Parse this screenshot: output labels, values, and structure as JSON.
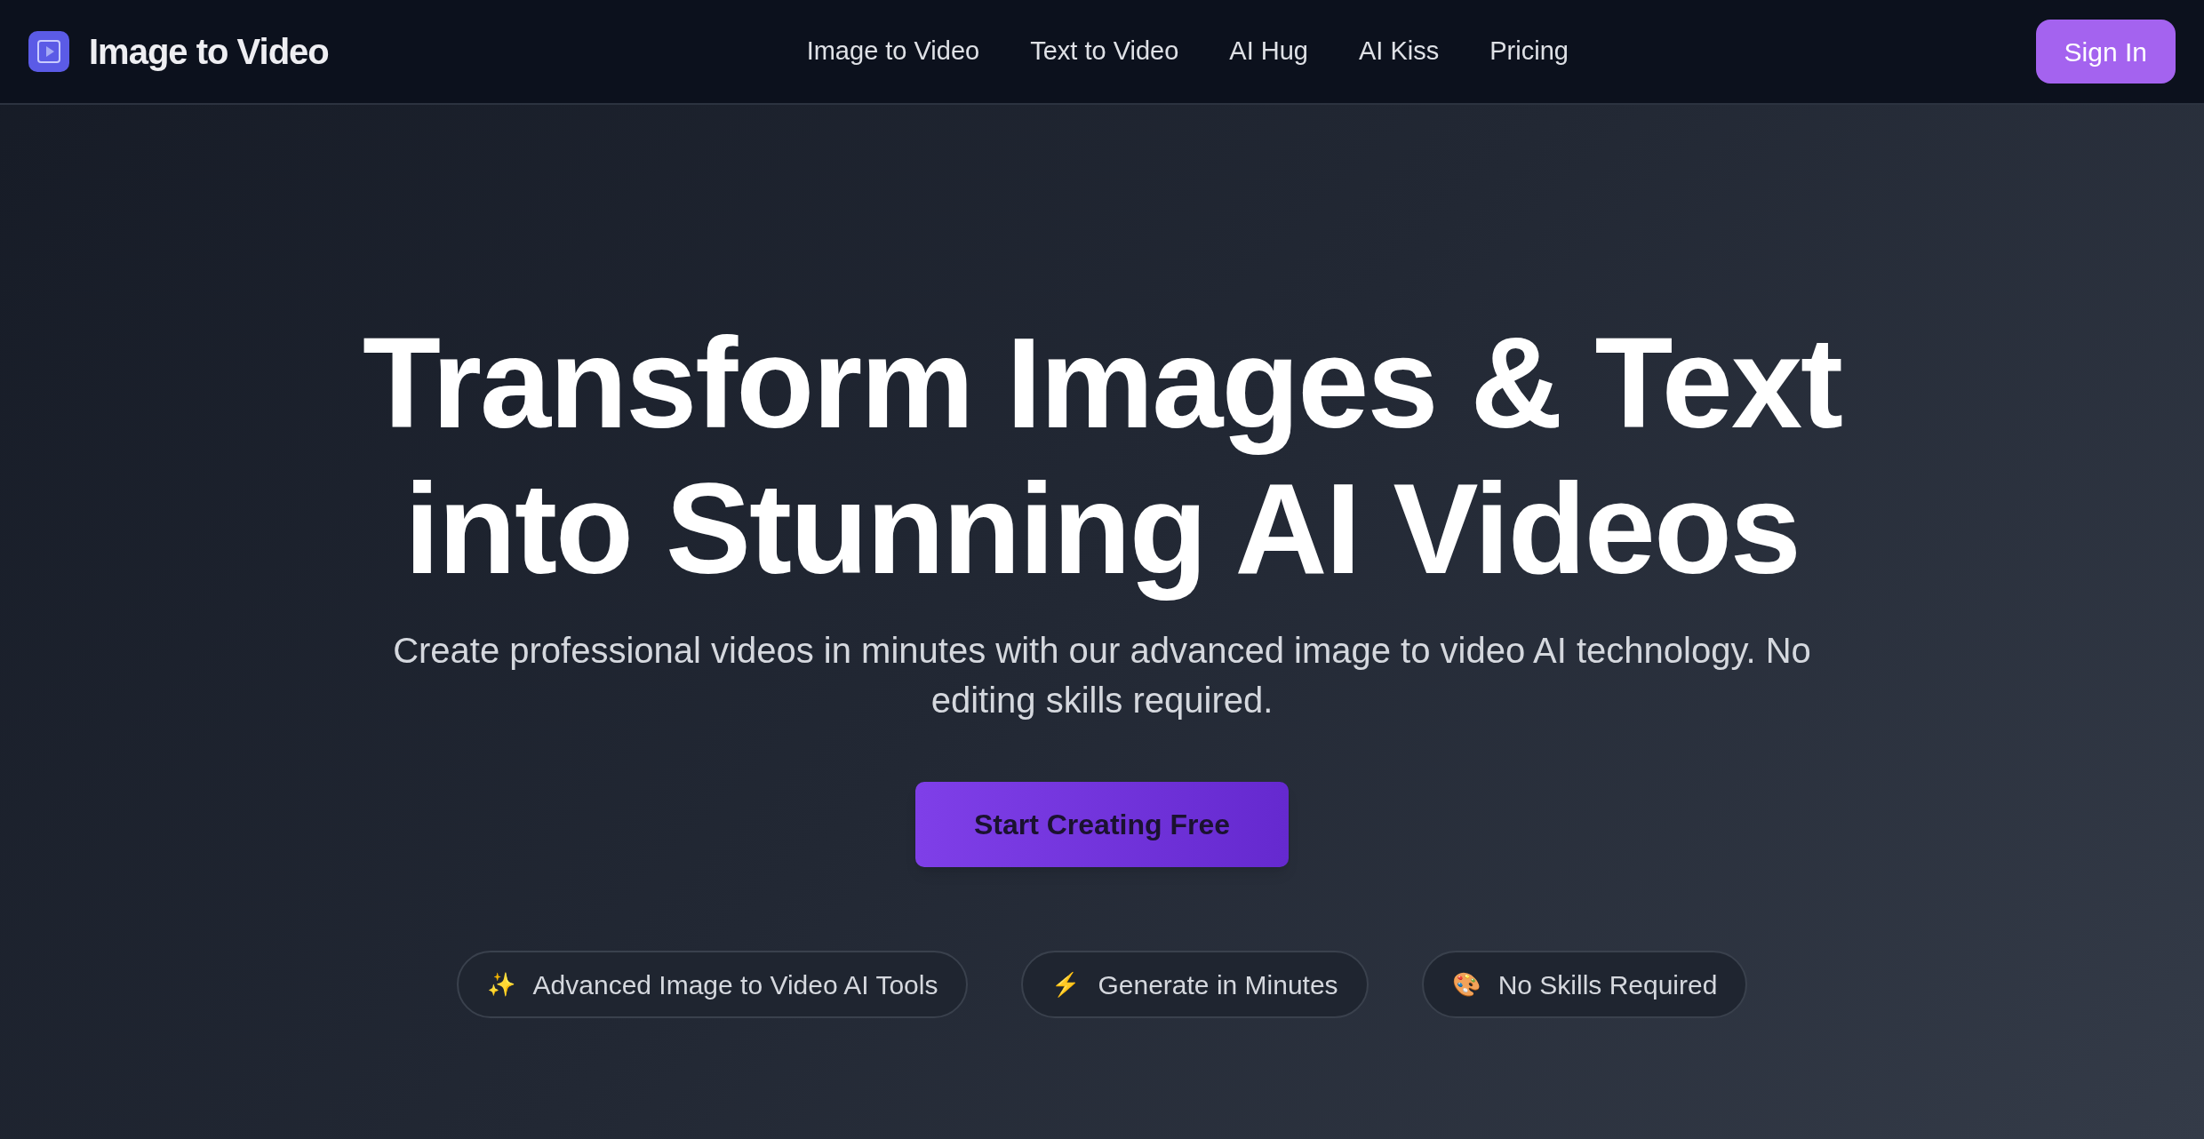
{
  "brand": {
    "name": "Image to Video"
  },
  "nav": [
    {
      "label": "Image to Video"
    },
    {
      "label": "Text to Video"
    },
    {
      "label": "AI Hug"
    },
    {
      "label": "AI Kiss"
    },
    {
      "label": "Pricing"
    }
  ],
  "sign_in": "Sign In",
  "hero": {
    "title_lines": [
      "Transform Images & Text",
      "into Stunning AI Videos"
    ],
    "subtitle": "Create professional videos in minutes with our advanced image to video AI technology. No editing skills required.",
    "cta": "Start Creating Free"
  },
  "features": [
    {
      "icon": "✨",
      "label": "Advanced Image to Video AI Tools"
    },
    {
      "icon": "⚡",
      "label": "Generate in Minutes"
    },
    {
      "icon": "🎨",
      "label": "No Skills Required"
    }
  ]
}
